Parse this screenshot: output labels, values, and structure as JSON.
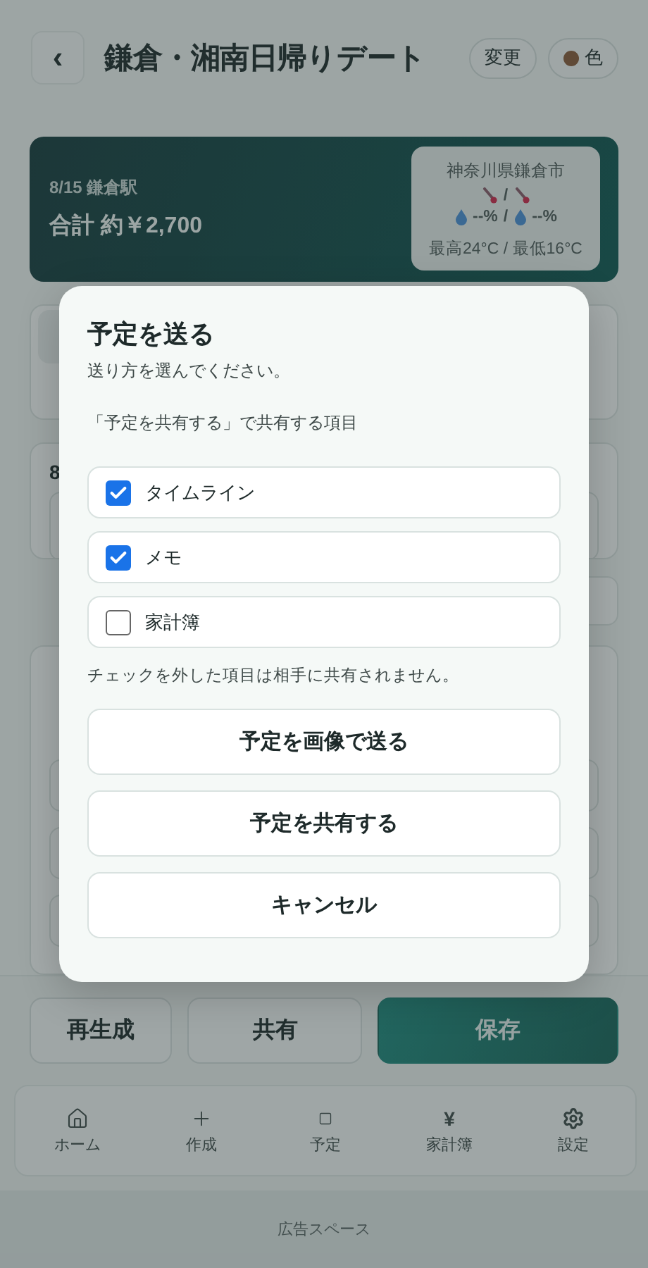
{
  "header": {
    "back_label": "‹",
    "title": "鎌倉・湘南日帰りデート",
    "change_button": "変更",
    "color_button": "色"
  },
  "summary": {
    "date_place": "8/15 鎌倉駅",
    "total": "合計 約￥2,700",
    "weather": {
      "location": "神奈川県鎌倉市",
      "temp_separator": "/",
      "rain": [
        "--%",
        "--%"
      ],
      "rain_separator": "/",
      "range": "最高24°C / 最低16°C"
    }
  },
  "schedule_card": {
    "title": "8"
  },
  "conditions_card": {
    "fields": [
      {
        "kind": "field"
      },
      {
        "kind": "field"
      },
      {
        "kind": "field"
      }
    ]
  },
  "actions": [
    {
      "label": "再生成",
      "kind": "secondary"
    },
    {
      "label": "共有",
      "kind": "secondary"
    },
    {
      "label": "保存",
      "kind": "primary"
    }
  ],
  "nav": [
    {
      "label": "ホーム"
    },
    {
      "label": "作成"
    },
    {
      "label": "予定"
    },
    {
      "glyph": "¥",
      "label": "家計簿"
    },
    {
      "label": "設定"
    }
  ],
  "ad": "広告スペース",
  "modal": {
    "title": "予定を送る",
    "subtitle": "送り方を選んでください。",
    "section_label": "「予定を共有する」で共有する項目",
    "items": [
      {
        "label": "タイムライン",
        "checked": true
      },
      {
        "label": "メモ",
        "checked": true
      },
      {
        "label": "家計簿",
        "checked": false
      }
    ],
    "note": "チェックを外した項目は相手に共有されません。",
    "buttons": [
      "予定を画像で送る",
      "予定を共有する",
      "キャンセル"
    ]
  }
}
